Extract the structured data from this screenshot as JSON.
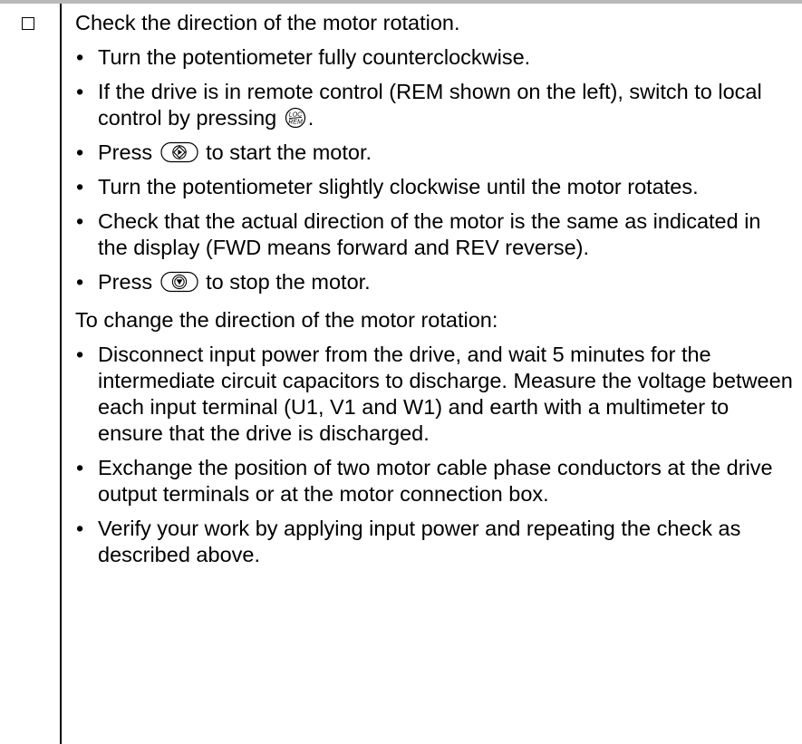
{
  "checklist": {
    "intro": "Check the direction of the motor rotation.",
    "steps": [
      {
        "before": "Turn the potentiometer fully counterclockwise."
      },
      {
        "before": "If the drive is in remote control (REM shown on the left), switch to local control by pressing ",
        "key": "loc-rem-key-icon",
        "after": "."
      },
      {
        "before": "Press ",
        "key": "start-key-icon",
        "after": " to start the motor."
      },
      {
        "before": "Turn the potentiometer slightly clockwise until the motor rotates."
      },
      {
        "before": "Check that the actual direction of the motor is the same as indicated in the display (FWD means forward and REV reverse)."
      },
      {
        "before": "Press ",
        "key": "stop-key-icon",
        "after": " to stop the motor."
      }
    ],
    "change_heading": "To change the direction of the motor rotation:",
    "change_steps": [
      {
        "before": "Disconnect input power from the drive, and wait 5 minutes for the intermediate circuit capacitors to discharge. Measure the voltage between each input terminal (U1, V1 and W1) and earth with a multimeter to ensure that the drive is discharged."
      },
      {
        "before": "Exchange the position of two motor cable phase conductors at the drive output terminals or at the motor connection box."
      },
      {
        "before": "Verify your work by applying input power and repeating the check as described above."
      }
    ],
    "bullet": "•",
    "loc_key_top": "LOC",
    "loc_key_bottom": "REM"
  }
}
